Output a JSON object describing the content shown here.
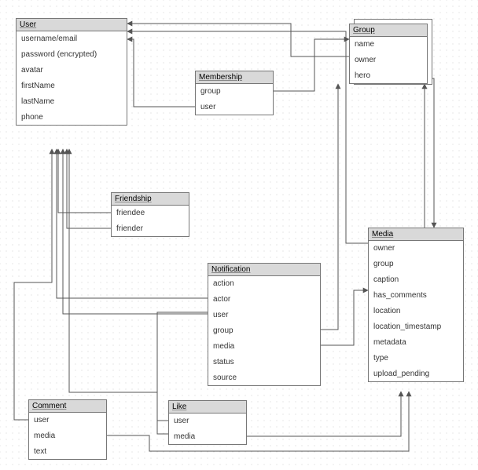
{
  "entities": {
    "user": {
      "title": "User",
      "fields": [
        "username/email",
        "password (encrypted)",
        "avatar",
        "firstName",
        "lastName",
        "phone"
      ]
    },
    "membership": {
      "title": "Membership",
      "fields": [
        "group",
        "user"
      ]
    },
    "group": {
      "title": "Group",
      "fields": [
        "name",
        "owner",
        "hero"
      ]
    },
    "friendship": {
      "title": "Friendship",
      "fields": [
        "friendee",
        "friender"
      ]
    },
    "notification": {
      "title": "Notification",
      "fields": [
        "action",
        "actor",
        "user",
        "group",
        "media",
        "status",
        "source"
      ]
    },
    "media": {
      "title": "Media",
      "fields": [
        "owner",
        "group",
        "caption",
        "has_comments",
        "location",
        "location_timestamp",
        "metadata",
        "type",
        "upload_pending"
      ]
    },
    "comment": {
      "title": "Comment",
      "fields": [
        "user",
        "media",
        "text"
      ]
    },
    "like": {
      "title": "Like",
      "fields": [
        "user",
        "media"
      ]
    }
  }
}
